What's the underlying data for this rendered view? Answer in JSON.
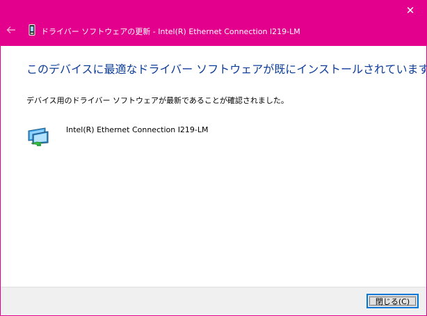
{
  "colors": {
    "accent": "#e3008c",
    "heading": "#0d3d99",
    "footer_bg": "#f0f0f0",
    "button_border": "#0078d7"
  },
  "titlebar": {
    "close_icon": "close-icon",
    "close_glyph": "✕"
  },
  "nav": {
    "back_icon": "back-arrow-icon",
    "device_icon": "device-manager-icon",
    "title": "ドライバー ソフトウェアの更新 - Intel(R) Ethernet Connection I219-LM"
  },
  "main": {
    "heading": "このデバイスに最適なドライバー ソフトウェアが既にインストールされています。",
    "description": "デバイス用のドライバー ソフトウェアが最新であることが確認されました。",
    "device": {
      "icon": "network-adapter-icon",
      "name": "Intel(R) Ethernet Connection I219-LM"
    }
  },
  "footer": {
    "close_button_label": "閉じる(C)"
  }
}
